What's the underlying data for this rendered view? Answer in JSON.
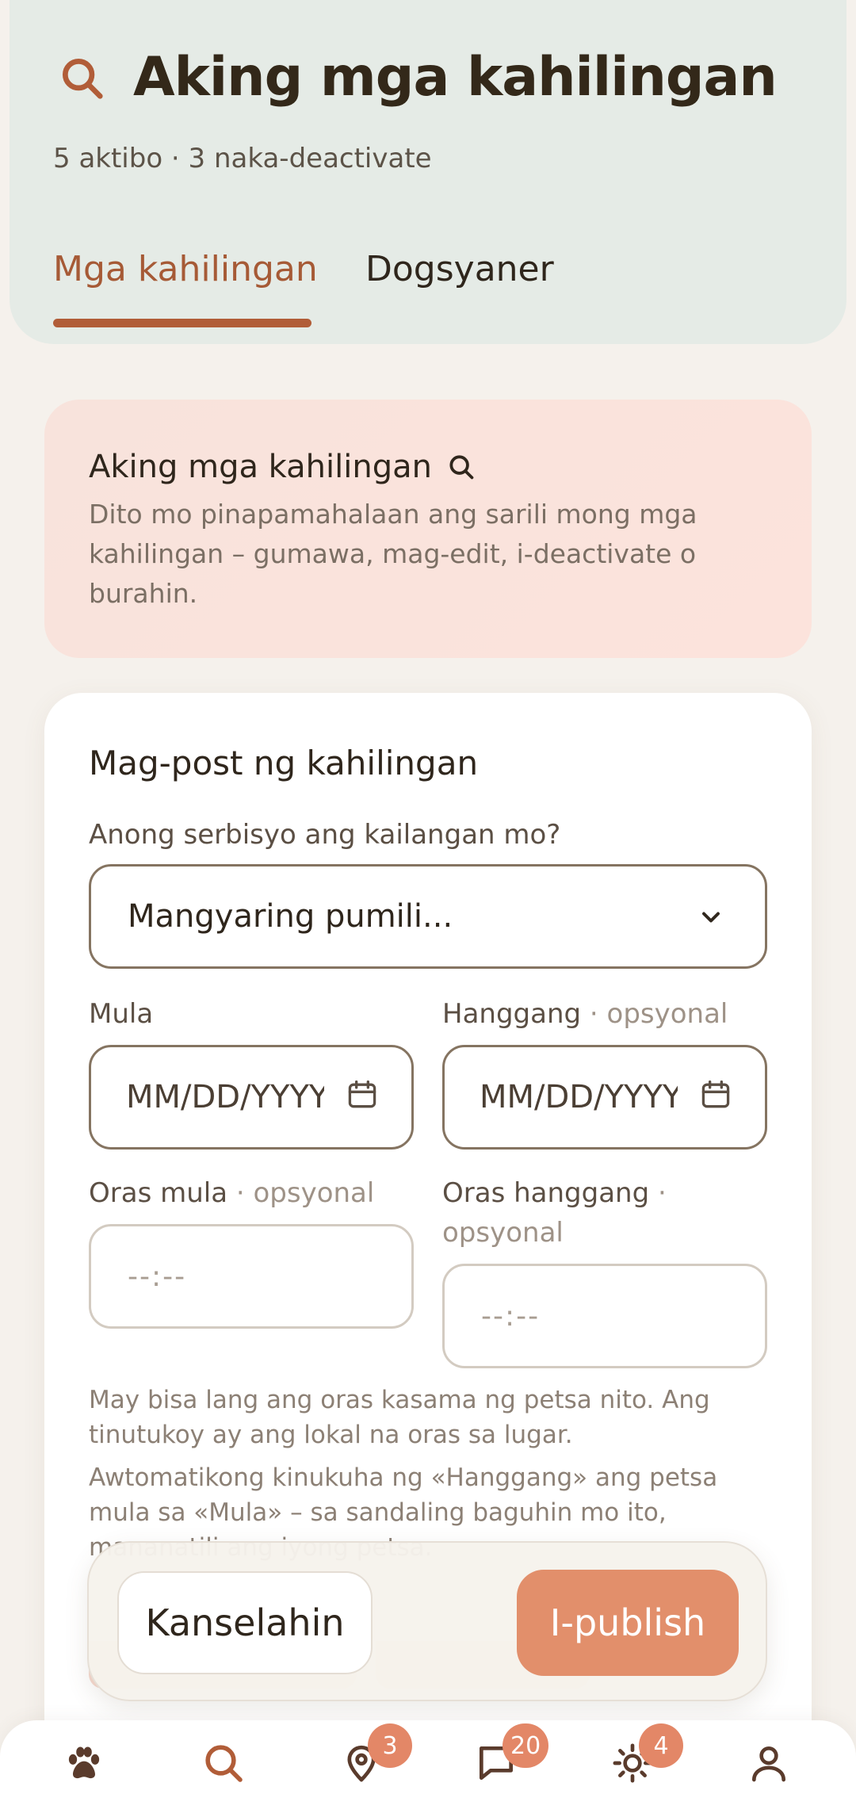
{
  "header": {
    "title": "Aking mga kahilingan",
    "subtitle": "5 aktibo · 3 naka-deactivate",
    "tabs": [
      {
        "label": "Mga kahilingan",
        "active": true
      },
      {
        "label": "Dogsyaner",
        "active": false
      }
    ],
    "title_icon": "search-icon"
  },
  "info_card": {
    "title": "Aking mga kahilingan",
    "icon": "search-icon",
    "body": "Dito mo pinapamahalaan ang sarili mong mga kahilingan – gumawa, mag-edit, i-deactivate o burahin."
  },
  "form": {
    "title": "Mag-post ng kahilingan",
    "service_label": "Anong serbisyo ang kailangan mo?",
    "service_value": "Mangyaring pumili...",
    "from_label": "Mula",
    "to_label": "Hanggang",
    "optional": "· opsyonal",
    "date_placeholder": "MM/DD/YYYY",
    "time_from_label": "Oras mula",
    "time_to_label": "Oras hanggang",
    "time_placeholder": "--:--",
    "note1": "May bisa lang ang oras kasama ng petsa nito. Ang tinutukoy ay ang lokal na oras sa lugar.",
    "note2": "Awtomatikong kinukuha ng «Hanggang» ang petsa mula sa «Mula» – sa sandaling baguhin mo ito, mananatili ang iyong petsa."
  },
  "actions": {
    "cancel": "Kanselahin",
    "publish": "I-publish"
  },
  "nav": {
    "items": [
      {
        "icon": "paw-icon",
        "badge": null
      },
      {
        "icon": "search-icon",
        "badge": null
      },
      {
        "icon": "location-pin-icon",
        "badge": "3"
      },
      {
        "icon": "chat-icon",
        "badge": "20"
      },
      {
        "icon": "sun-icon",
        "badge": "4"
      },
      {
        "icon": "user-icon",
        "badge": null
      }
    ]
  },
  "colors": {
    "accent": "#b15d38",
    "publish": "#e28f6b",
    "badge": "#e38767",
    "header_bg": "#e5ebe6"
  }
}
